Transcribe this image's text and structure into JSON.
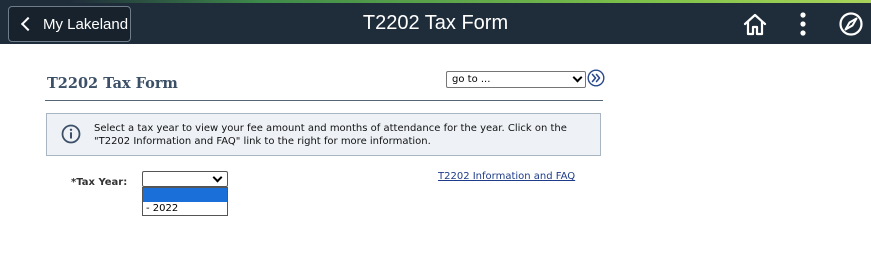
{
  "header": {
    "back_label": "My Lakeland",
    "title": "T2202 Tax Form",
    "icons": [
      "home-icon",
      "more-vertical-icon",
      "navbar-compass-icon"
    ]
  },
  "page": {
    "title": "T2202 Tax Form",
    "goto": {
      "selected": "go to ..."
    },
    "info_text_line1": "Select a tax year to view your fee amount and months of attendance for the year. Click on the",
    "info_text_line2": "\"T2202 Information and FAQ\" link to the right for more information.",
    "tax_year_label": "*Tax Year:",
    "tax_year_value": "",
    "tax_year_options": [
      "",
      "- 2022"
    ],
    "faq_link": "T2202 Information and FAQ"
  },
  "colors": {
    "header_bg": "#1f2d3b",
    "accent_green": "#7fc24a",
    "title_color": "#3b4f66",
    "info_bg": "#eef2f7",
    "selected_option": "#1a6fd9",
    "link": "#1f3c8a"
  }
}
